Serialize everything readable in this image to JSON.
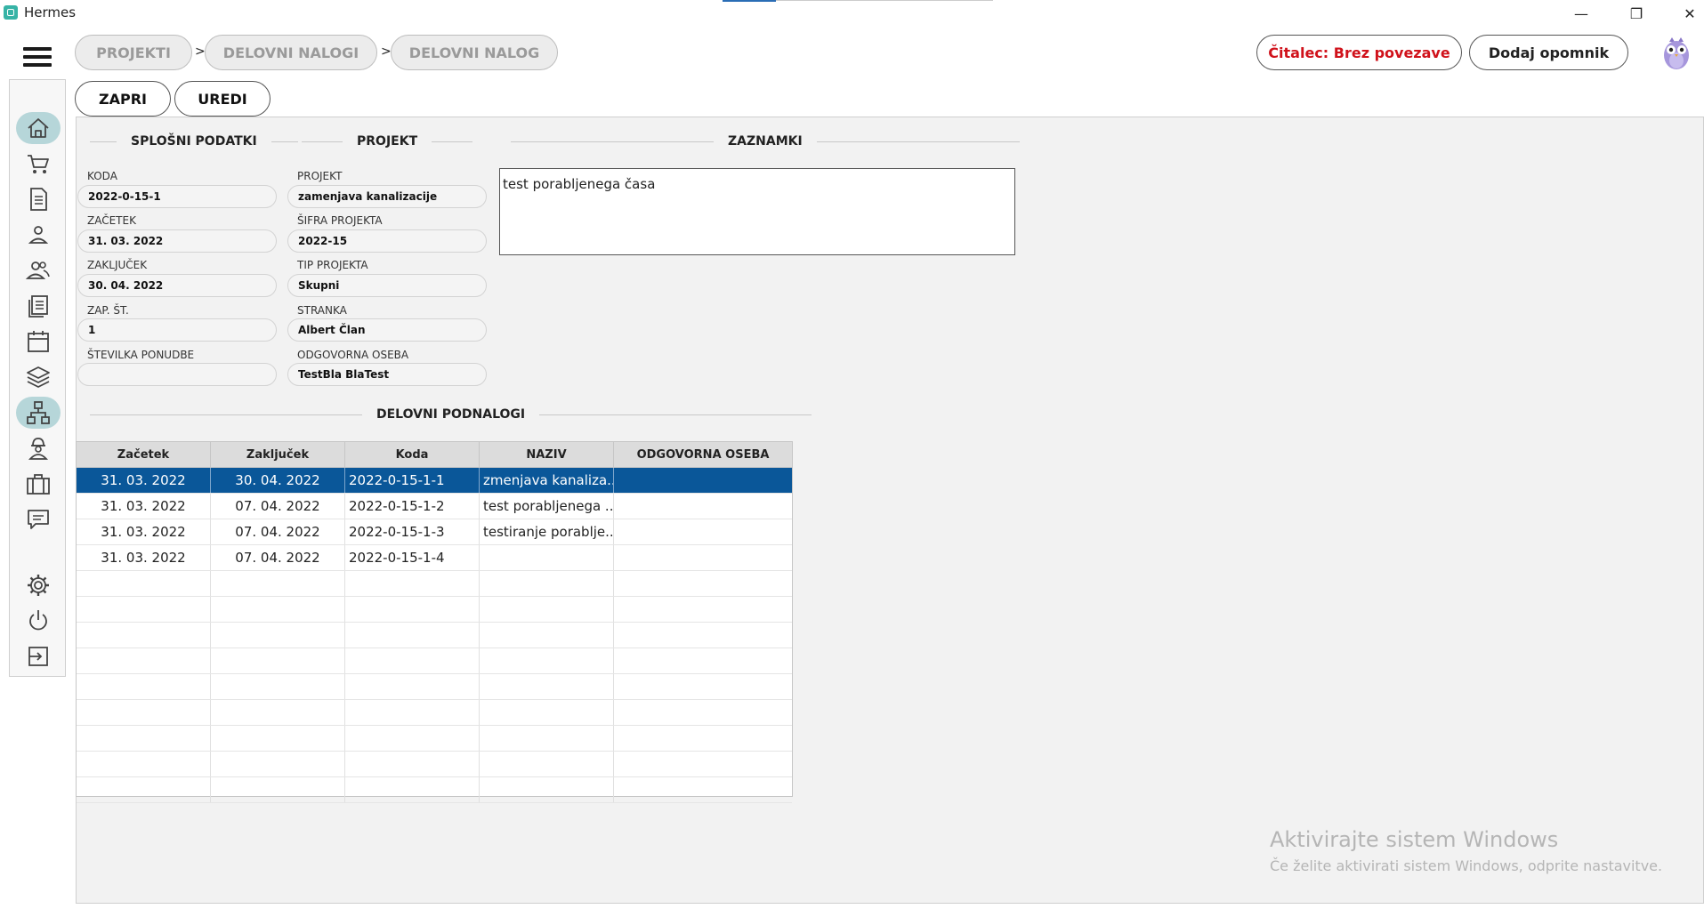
{
  "window": {
    "title": "Hermes",
    "minimize": "—",
    "maximize": "❐",
    "close": "✕"
  },
  "breadcrumbs": [
    {
      "label": "PROJEKTI"
    },
    {
      "label": "DELOVNI NALOGI"
    },
    {
      "label": "DELOVNI NALOG"
    }
  ],
  "breadcrumb_sep": ">",
  "header": {
    "reader_label": "Čitalec: Brez povezave",
    "add_reminder_label": "Dodaj opomnik"
  },
  "actions": {
    "close_label": "ZAPRI",
    "edit_label": "UREDI"
  },
  "sidebar": {
    "items": [
      {
        "icon": "home-icon"
      },
      {
        "icon": "cart-icon"
      },
      {
        "icon": "document-icon"
      },
      {
        "icon": "user-icon"
      },
      {
        "icon": "users-icon"
      },
      {
        "icon": "list-document-icon"
      },
      {
        "icon": "calendar-icon"
      },
      {
        "icon": "layers-icon"
      },
      {
        "icon": "hierarchy-icon",
        "active": true
      },
      {
        "icon": "worker-icon"
      },
      {
        "icon": "briefcase-icon"
      },
      {
        "icon": "chat-icon"
      },
      {
        "icon": "gear-icon"
      },
      {
        "icon": "power-icon"
      },
      {
        "icon": "logout-icon"
      }
    ]
  },
  "general": {
    "title": "SPLOŠNI PODATKI",
    "koda_label": "KODA",
    "koda_value": "2022-0-15-1",
    "zacetek_label": "ZAČETEK",
    "zacetek_value": "31. 03. 2022",
    "zakljucek_label": "ZAKLJUČEK",
    "zakljucek_value": "30. 04. 2022",
    "zapst_label": "ZAP. ŠT.",
    "zapst_value": "1",
    "ponudba_label": "ŠTEVILKA PONUDBE",
    "ponudba_value": ""
  },
  "project": {
    "title": "PROJEKT",
    "projekt_label": "PROJEKT",
    "projekt_value": "zamenjava kanalizacije",
    "sifra_label": "ŠIFRA PROJEKTA",
    "sifra_value": "2022-15",
    "tip_label": "TIP PROJEKTA",
    "tip_value": "Skupni",
    "stranka_label": "STRANKA",
    "stranka_value": "Albert Član",
    "oseba_label": "ODGOVORNA OSEBA",
    "oseba_value": "TestBla BlaTest"
  },
  "notes": {
    "title": "ZAZNAMKI",
    "text": "test porabljenega časa"
  },
  "subtasks": {
    "title": "DELOVNI PODNALOGI",
    "columns": [
      "Začetek",
      "Zaključek",
      "Koda",
      "NAZIV",
      "ODGOVORNA OSEBA"
    ],
    "rows": [
      [
        "31. 03. 2022",
        "30. 04. 2022",
        "2022-0-15-1-1",
        "zmenjava kanaliza...",
        ""
      ],
      [
        "31. 03. 2022",
        "07. 04. 2022",
        "2022-0-15-1-2",
        "test porabljenega ...",
        ""
      ],
      [
        "31. 03. 2022",
        "07. 04. 2022",
        "2022-0-15-1-3",
        "testiranje porablje...",
        ""
      ],
      [
        "31. 03. 2022",
        "07. 04. 2022",
        "2022-0-15-1-4",
        "",
        ""
      ]
    ],
    "selected_row": 0
  },
  "watermark": {
    "line1": "Aktivirajte sistem Windows",
    "line2": "Če želite aktivirati sistem Windows, odprite nastavitve."
  },
  "colors": {
    "accent": "#0a5799",
    "active_nav": "#b6d6d9",
    "reader_text": "#d0121b"
  }
}
